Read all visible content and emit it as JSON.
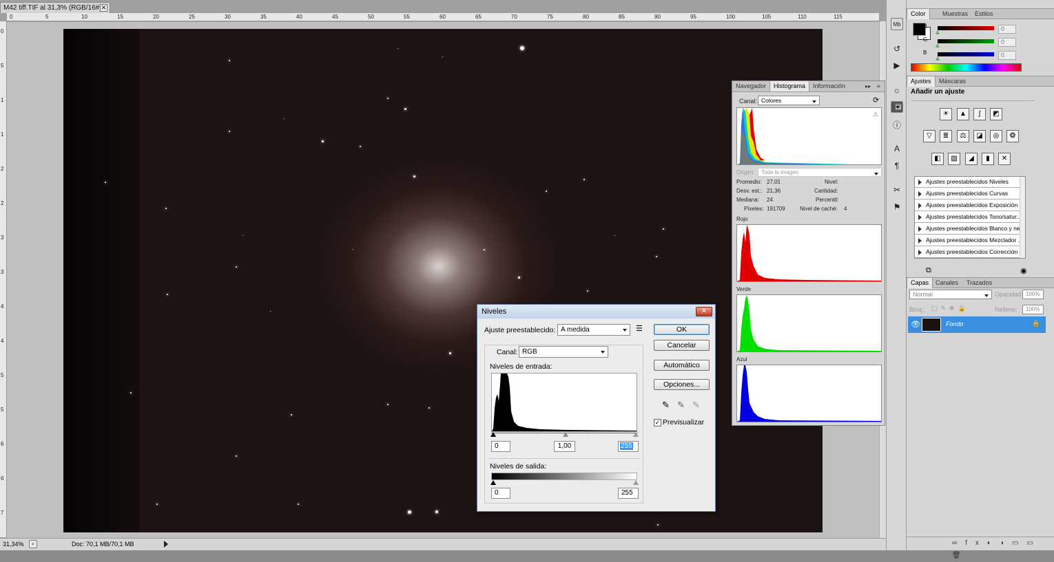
{
  "document": {
    "tab_title": "M42 tiff.TIF al 31,3% (RGB/16#)",
    "ruler_h": [
      "0",
      "5",
      "10",
      "15",
      "20",
      "25",
      "30",
      "35",
      "40",
      "45",
      "50",
      "55",
      "60",
      "65",
      "70",
      "75",
      "80",
      "85",
      "90",
      "95",
      "100",
      "105",
      "110",
      "115"
    ],
    "ruler_v": [
      "0",
      "5",
      "1",
      "1",
      "2",
      "2",
      "3",
      "3",
      "4",
      "4",
      "5",
      "5",
      "6",
      "6",
      "7"
    ],
    "status": {
      "zoom": "31,34%",
      "doc": "Doc: 70,1 MB/70,1 MB"
    }
  },
  "color_panel": {
    "tabs": [
      "Color",
      "Muestras",
      "Estilos"
    ],
    "channels": [
      {
        "label": "R",
        "value": "0",
        "color": "#e00000"
      },
      {
        "label": "G",
        "value": "0",
        "color": "#00a000"
      },
      {
        "label": "B",
        "value": "0",
        "color": "#0000e0"
      }
    ]
  },
  "adjust_panel": {
    "tabs": [
      "Ajustes",
      "Máscaras"
    ],
    "title": "Añadir un ajuste",
    "presets": [
      "Ajustes preestablecidos Niveles",
      "Ajustes preestablecidos Curvas",
      "Ajustes preestablecidos Exposición",
      "Ajustes preestablecidos Tono/satur...",
      "Ajustes preestablecidos Blanco y ne...",
      "Ajustes preestablecidos Mezclador ...",
      "Ajustes preestablecidos Corrección ..."
    ]
  },
  "layers_panel": {
    "tabs": [
      "Capas",
      "Canales",
      "Trazados"
    ],
    "blend_mode": "Normal",
    "opacity_label": "Opacidad:",
    "opacity": "100%",
    "lock_label": "Bloq.:",
    "fill_label": "Relleno:",
    "fill": "100%",
    "layer_name": "Fondo"
  },
  "histogram_panel": {
    "tabs": [
      "Navegador",
      "Histograma",
      "Información"
    ],
    "canal_label": "Canal:",
    "canal_value": "Colores",
    "origen_label": "Origen:",
    "origen_value": "Toda la imagen",
    "stats": {
      "promedio_label": "Promedio:",
      "promedio": "27,01",
      "desv_label": "Desv. est.:",
      "desv": "21,36",
      "mediana_label": "Mediana:",
      "mediana": "24",
      "pixeles_label": "Píxeles:",
      "pixeles": "191709",
      "nivel_label": "Nivel:",
      "cantidad_label": "Cantidad:",
      "percentil_label": "Percentil:",
      "cache_label": "Nivel de caché:",
      "cache": "4"
    },
    "channels": [
      {
        "label": "Rojo",
        "color": "#e00000"
      },
      {
        "label": "Verde",
        "color": "#00e000"
      },
      {
        "label": "Azul",
        "color": "#0000e0"
      }
    ]
  },
  "levels_dialog": {
    "title": "Niveles",
    "preset_label": "Ajuste preestablecido:",
    "preset_value": "A medida",
    "canal_label": "Canal:",
    "canal_value": "RGB",
    "input_label": "Niveles de entrada:",
    "input_black": "0",
    "input_gamma": "1,00",
    "input_white": "255",
    "output_label": "Niveles de salida:",
    "output_black": "0",
    "output_white": "255",
    "buttons": {
      "ok": "OK",
      "cancel": "Cancelar",
      "auto": "Automático",
      "options": "Opciones..."
    },
    "preview_label": "Previsualizar",
    "preview_checked": true
  }
}
